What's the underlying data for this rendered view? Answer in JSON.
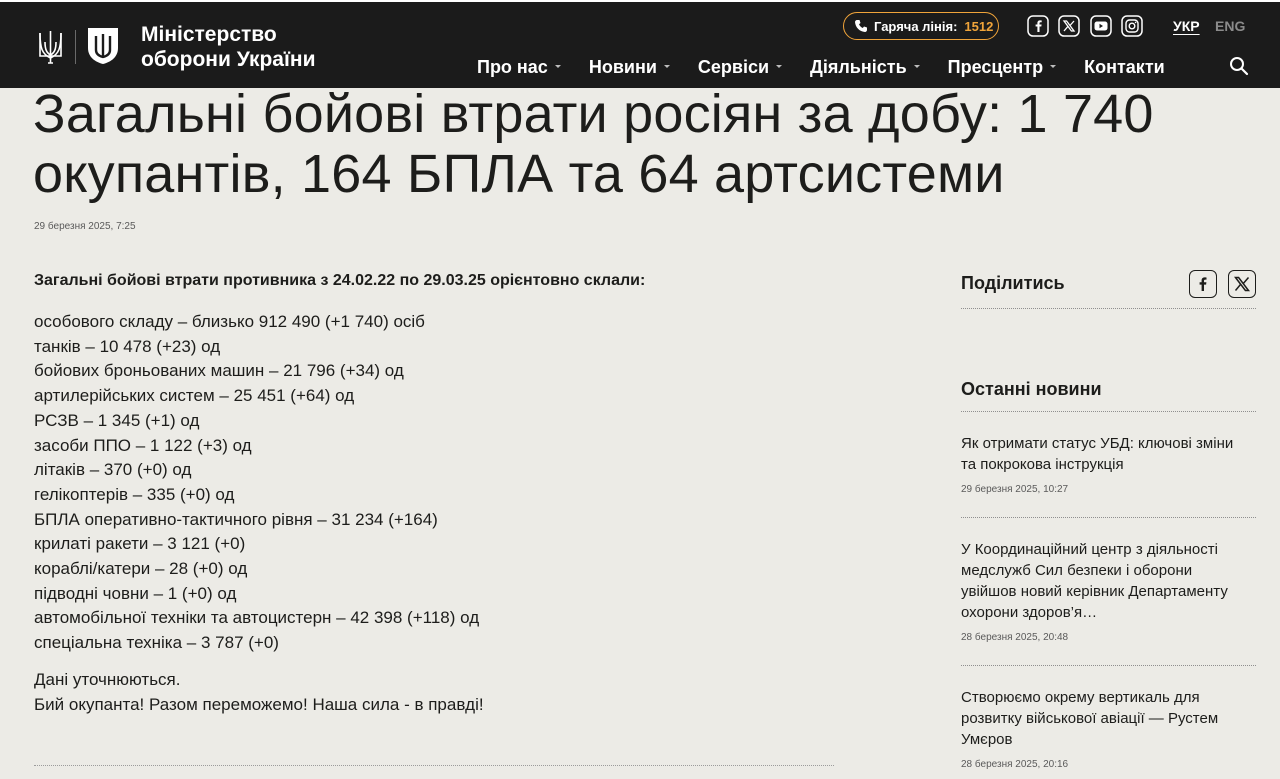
{
  "header": {
    "brand_line1": "Міністерство",
    "brand_line2": "оборони України",
    "hotline_label": "Гаряча лінія:",
    "hotline_number": "1512",
    "accent_color": "#f0a43a",
    "social_icons": [
      "facebook-icon",
      "x-icon",
      "youtube-icon",
      "instagram-icon"
    ],
    "languages": [
      {
        "code": "УКР",
        "active": true
      },
      {
        "code": "ENG",
        "active": false
      }
    ],
    "nav": [
      {
        "label": "Про нас",
        "has_dropdown": true
      },
      {
        "label": "Новини",
        "has_dropdown": true
      },
      {
        "label": "Сервіси",
        "has_dropdown": true
      },
      {
        "label": "Діяльність",
        "has_dropdown": true
      },
      {
        "label": "Пресцентр",
        "has_dropdown": true
      },
      {
        "label": "Контакти",
        "has_dropdown": false
      }
    ]
  },
  "article": {
    "title": "Загальні бойові втрати росіян за добу: 1 740 окупантів, 164 БПЛА та 64 артсистеми",
    "date": "29 березня 2025, 7:25",
    "lead": "Загальні бойові втрати противника з 24.02.22 по 29.03.25 орієнтовно склали:",
    "losses": [
      "особового складу – близько 912 490 (+1 740) осіб",
      "танків – 10 478 (+23) од",
      "бойових броньованих машин – 21 796 (+34) од",
      "артилерійських систем – 25 451 (+64) од",
      "РСЗВ – 1 345 (+1) од",
      "засоби ППО – 1 122 (+3) од",
      "літаків – 370 (+0) од",
      "гелікоптерів – 335 (+0) од",
      "БПЛА оперативно-тактичного рівня – 31 234 (+164)",
      "крилаті ракети – 3 121 (+0)",
      "кораблі/катери – 28 (+0) од",
      "підводні човни – 1 (+0) од",
      "автомобільної техніки та автоцистерн – 42 398 (+118) од",
      "спеціальна техніка – 3 787 (+0)"
    ],
    "note1": "Дані уточнюються.",
    "note2": "Бий окупанта! Разом переможемо! Наша сила - в правді!"
  },
  "sidebar": {
    "share_title": "Поділитись",
    "share_icons": [
      "facebook-icon",
      "x-icon"
    ],
    "latest_title": "Останні новини",
    "news": [
      {
        "title": "Як отримати статус УБД: ключові зміни та покрокова інструкція",
        "date": "29 березня 2025, 10:27"
      },
      {
        "title": "У Координаційний центр з діяльності медслужб Сил безпеки і оборони увійшов новий керівник Департаменту охорони здоров’я…",
        "date": "28 березня 2025, 20:48"
      },
      {
        "title": "Створюємо окрему вертикаль для розвитку військової авіації — Рустем Умєров",
        "date": "28 березня 2025, 20:16"
      }
    ]
  }
}
